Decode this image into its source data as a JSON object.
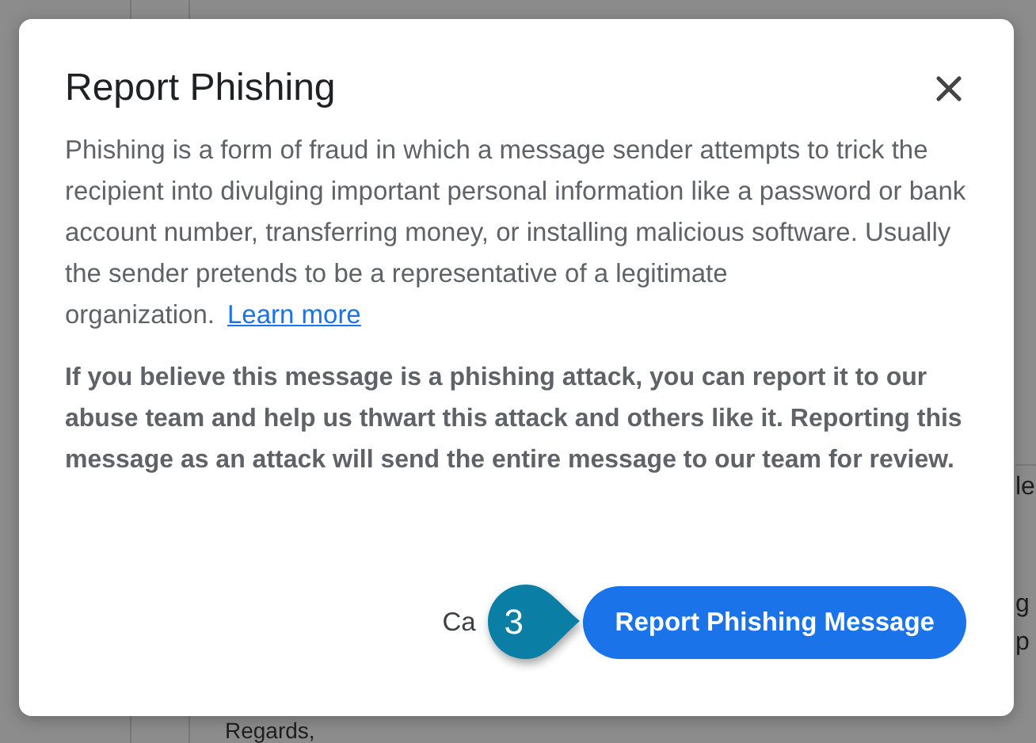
{
  "background_page": {
    "fragments": [
      "le",
      "g",
      "p"
    ],
    "closing": "Regards,"
  },
  "dialog": {
    "title": "Report Phishing",
    "description": "Phishing is a form of fraud in which a message sender attempts to trick the recipient into divulging important personal information like a password or bank account number, transferring money, or installing malicious software. Usually the sender pretends to be a representative of a legitimate organization.",
    "learn_more_link": "Learn more",
    "notice": "If you believe this message is a phishing attack, you can report it to our abuse team and help us thwart this attack and others like it. Reporting this message as an attack will send the entire message to our team for review.",
    "buttons": [
      {
        "label": "Ca",
        "kind": "text"
      },
      {
        "label": "Report Phishing Message",
        "kind": "primary"
      }
    ]
  },
  "callout": {
    "number": "3"
  }
}
